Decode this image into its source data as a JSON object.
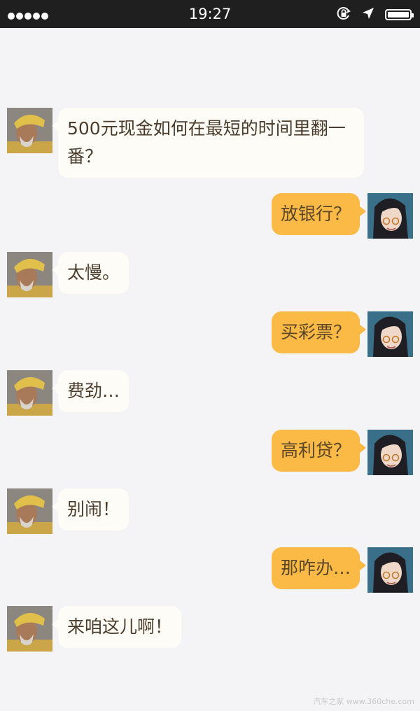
{
  "status_bar": {
    "time": "19:27",
    "signal_dots": 5,
    "icons": [
      "rotation-lock-icon",
      "location-arrow-icon",
      "battery-icon"
    ],
    "battery_level": 1.0
  },
  "messages": [
    {
      "side": "left",
      "text": "500元现金如何在最短的时间里翻一番？"
    },
    {
      "side": "right",
      "text": "放银行？"
    },
    {
      "side": "left",
      "text": "太慢。"
    },
    {
      "side": "right",
      "text": "买彩票？"
    },
    {
      "side": "left",
      "text": "费劲…"
    },
    {
      "side": "right",
      "text": "高利贷？"
    },
    {
      "side": "left",
      "text": "别闹！"
    },
    {
      "side": "right",
      "text": "那咋办…"
    },
    {
      "side": "left",
      "text": "来咱这儿啊！"
    }
  ],
  "watermark": "汽车之家 www.360che.com",
  "colors": {
    "incoming_bubble": "#fefcf6",
    "outgoing_bubble": "#fbb946",
    "background": "#f4f4f6",
    "status_bar": "#1f1f1f"
  }
}
